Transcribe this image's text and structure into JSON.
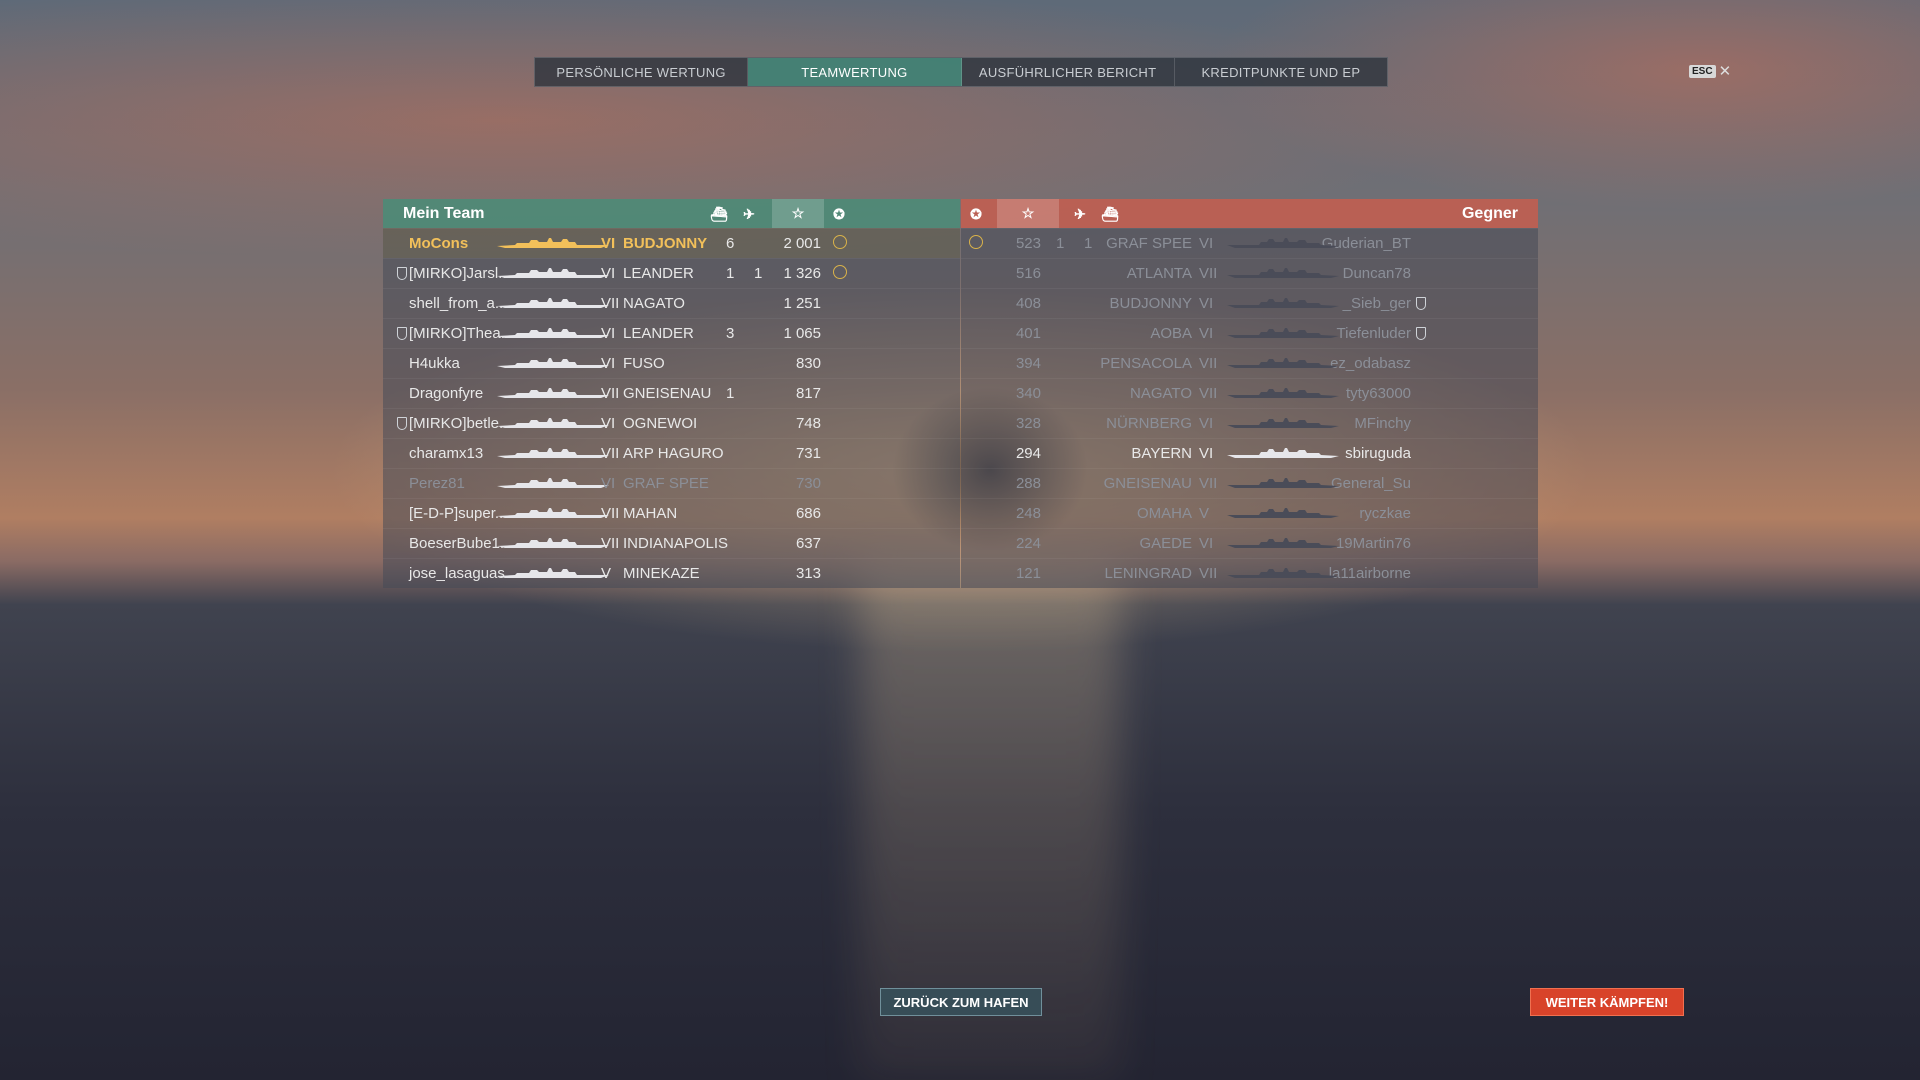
{
  "tabs": [
    "PERSÖNLICHE WERTUNG",
    "TEAMWERTUNG",
    "AUSFÜHRLICHER BERICHT",
    "KREDITPUNKTE UND EP"
  ],
  "active_tab": 1,
  "close": {
    "key": "ESC",
    "icon": "close-icon"
  },
  "my_team": {
    "title": "Mein Team",
    "column_icons": [
      "ship-sunk-icon",
      "planes-shot-icon",
      "star-icon",
      "medal-icon"
    ],
    "rows": [
      {
        "name": "MoCons",
        "clan_icon": false,
        "tier": "VI",
        "ship": "BUDJONNY",
        "kills": "6",
        "planes": "",
        "xp": "2 001",
        "medal": true,
        "me": true
      },
      {
        "name": "[MIRKO]Jarsl...",
        "clan_icon": true,
        "tier": "VI",
        "ship": "LEANDER",
        "kills": "1",
        "planes": "1",
        "xp": "1 326",
        "medal": true
      },
      {
        "name": "shell_from_a...",
        "clan_icon": false,
        "tier": "VII",
        "ship": "NAGATO",
        "kills": "",
        "planes": "",
        "xp": "1 251",
        "medal": false
      },
      {
        "name": "[MIRKO]Thea...",
        "clan_icon": true,
        "tier": "VI",
        "ship": "LEANDER",
        "kills": "3",
        "planes": "",
        "xp": "1 065",
        "medal": false
      },
      {
        "name": "H4ukka",
        "clan_icon": false,
        "tier": "VI",
        "ship": "FUSO",
        "kills": "",
        "planes": "",
        "xp": "830",
        "medal": false
      },
      {
        "name": "Dragonfyre",
        "clan_icon": false,
        "tier": "VII",
        "ship": "GNEISENAU",
        "kills": "1",
        "planes": "",
        "xp": "817",
        "medal": false
      },
      {
        "name": "[MIRKO]betle...",
        "clan_icon": true,
        "tier": "VI",
        "ship": "OGNEWOI",
        "kills": "",
        "planes": "",
        "xp": "748",
        "medal": false
      },
      {
        "name": "charamx13",
        "clan_icon": false,
        "tier": "VII",
        "ship": "ARP HAGURO",
        "kills": "",
        "planes": "",
        "xp": "731",
        "medal": false
      },
      {
        "name": "Perez81",
        "clan_icon": false,
        "tier": "VI",
        "ship": "GRAF SPEE",
        "kills": "",
        "planes": "",
        "xp": "730",
        "medal": false,
        "dim": true
      },
      {
        "name": "[E-D-P]super...",
        "clan_icon": false,
        "tier": "VII",
        "ship": "MAHAN",
        "kills": "",
        "planes": "",
        "xp": "686",
        "medal": false
      },
      {
        "name": "BoeserBube1...",
        "clan_icon": false,
        "tier": "VII",
        "ship": "INDIANAPOLIS",
        "kills": "",
        "planes": "",
        "xp": "637",
        "medal": false
      },
      {
        "name": "jose_lasaguas",
        "clan_icon": false,
        "tier": "V",
        "ship": "MINEKAZE",
        "kills": "",
        "planes": "",
        "xp": "313",
        "medal": false
      }
    ]
  },
  "enemy_team": {
    "title": "Gegner",
    "column_icons": [
      "medal-icon",
      "star-icon",
      "planes-shot-icon",
      "ship-sunk-icon"
    ],
    "rows": [
      {
        "name": "Guderian_BT",
        "clan_icon": false,
        "tier": "VI",
        "ship": "GRAF SPEE",
        "kills": "1",
        "planes": "1",
        "xp": "523",
        "medal": true,
        "dim": true
      },
      {
        "name": "Duncan78",
        "clan_icon": false,
        "tier": "VII",
        "ship": "ATLANTA",
        "kills": "",
        "planes": "",
        "xp": "516",
        "medal": false,
        "dim": true
      },
      {
        "name": "_Sieb_ger",
        "clan_icon": true,
        "tier": "VI",
        "ship": "BUDJONNY",
        "kills": "",
        "planes": "",
        "xp": "408",
        "medal": false,
        "dim": true
      },
      {
        "name": "Tiefenluder",
        "clan_icon": true,
        "tier": "VI",
        "ship": "AOBA",
        "kills": "",
        "planes": "",
        "xp": "401",
        "medal": false,
        "dim": true
      },
      {
        "name": "ez_odabasz",
        "clan_icon": false,
        "tier": "VII",
        "ship": "PENSACOLA",
        "kills": "",
        "planes": "",
        "xp": "394",
        "medal": false,
        "dim": true
      },
      {
        "name": "tyty63000",
        "clan_icon": false,
        "tier": "VII",
        "ship": "NAGATO",
        "kills": "",
        "planes": "",
        "xp": "340",
        "medal": false,
        "dim": true
      },
      {
        "name": "MFinchy",
        "clan_icon": false,
        "tier": "VI",
        "ship": "NÜRNBERG",
        "kills": "",
        "planes": "",
        "xp": "328",
        "medal": false,
        "dim": true
      },
      {
        "name": "sbiruguda",
        "clan_icon": false,
        "tier": "VI",
        "ship": "BAYERN",
        "kills": "",
        "planes": "",
        "xp": "294",
        "medal": false
      },
      {
        "name": "General_Su",
        "clan_icon": false,
        "tier": "VII",
        "ship": "GNEISENAU",
        "kills": "",
        "planes": "",
        "xp": "288",
        "medal": false,
        "dim": true
      },
      {
        "name": "ryczkae",
        "clan_icon": false,
        "tier": "V",
        "ship": "OMAHA",
        "kills": "",
        "planes": "",
        "xp": "248",
        "medal": false,
        "dim": true
      },
      {
        "name": "19Martin76",
        "clan_icon": false,
        "tier": "VI",
        "ship": "GAEDE",
        "kills": "",
        "planes": "",
        "xp": "224",
        "medal": false,
        "dim": true
      },
      {
        "name": "la11airborne",
        "clan_icon": false,
        "tier": "VII",
        "ship": "LENINGRAD",
        "kills": "",
        "planes": "",
        "xp": "121",
        "medal": false,
        "dim": true
      }
    ]
  },
  "buttons": {
    "back": "ZURÜCK ZUM HAFEN",
    "fight": "WEITER KÄMPFEN!"
  },
  "colors": {
    "my_team_header": "#4b8c78",
    "enemy_header": "#c35f50",
    "self_highlight": "#f2c05a",
    "fight_button": "#d8432a"
  }
}
